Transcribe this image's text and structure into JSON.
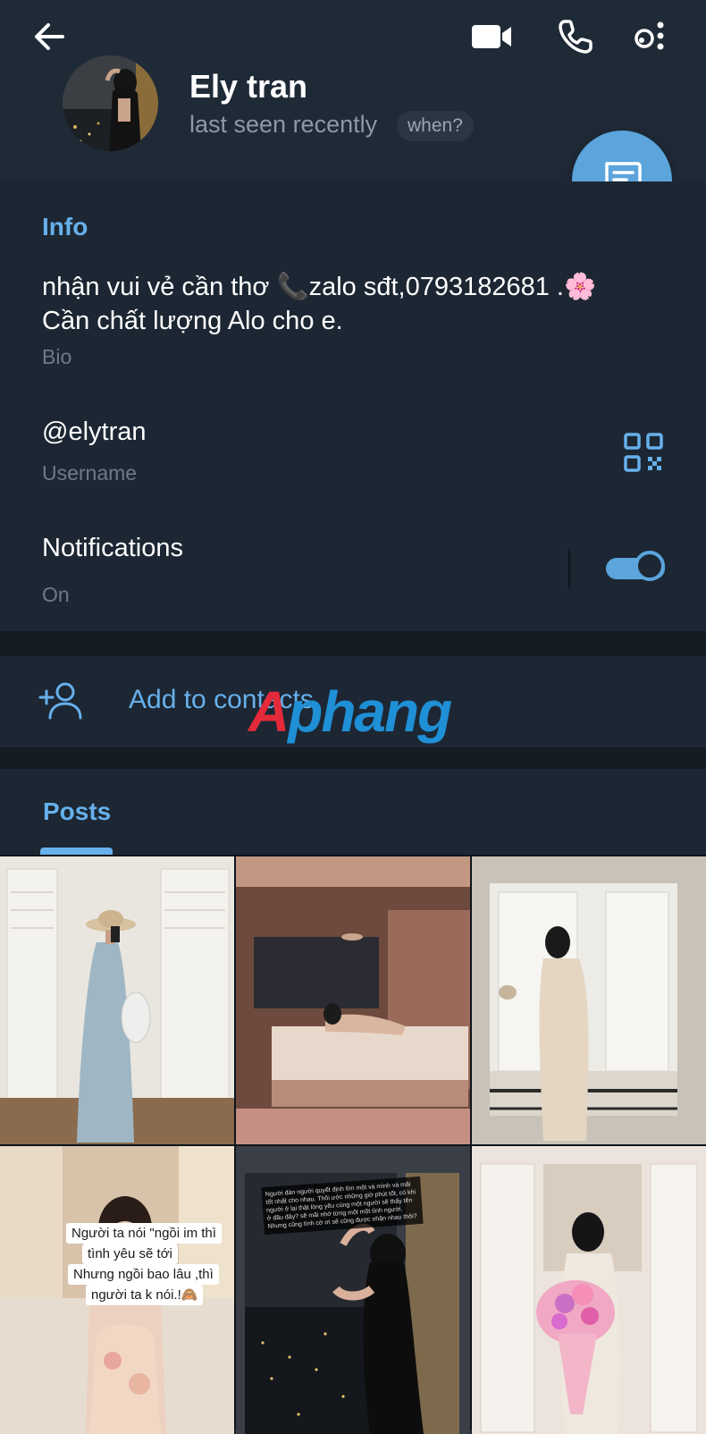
{
  "header": {
    "name": "Ely tran",
    "status": "last seen recently",
    "when_badge": "when?"
  },
  "info": {
    "section_title": "Info",
    "bio": {
      "line1": "nhận vui vẻ cần thơ 📞zalo sđt,0793182681 .🌸",
      "line2": "Cần chất lượng Alo cho e.",
      "label": "Bio"
    },
    "username": {
      "value": "@elytran",
      "label": "Username"
    },
    "notifications": {
      "label": "Notifications",
      "value": "On",
      "enabled": true
    }
  },
  "actions": {
    "add_to_contacts": "Add to contacts"
  },
  "watermark": {
    "part1": "A",
    "part2": "phang"
  },
  "posts": {
    "tab_label": "Posts",
    "captions": {
      "post4": [
        "Người ta nói \"ngồi im thì",
        "tình yêu sẽ tới",
        "Nhưng ngồi bao lâu ,thì",
        "người ta k nói.!🙈"
      ],
      "post5": "Người đàn người quyết định tìm một và mình và mãi tốt nhất cho nhau. Thôi ước những giờ phút tốt, có khi người ở lại thật lòng yêu cùng một người sẽ thấy tên ở đâu đây? sẽ mãi nhớ từng một một tình người. Nhưng cũng tình cờ ơi sẽ cũng được nhận nhau thôi?"
    }
  },
  "colors": {
    "accent": "#67b0ec",
    "fab": "#5ba4dc",
    "background": "#1c2733",
    "header": "#1f2a37"
  },
  "icons": {
    "back": "arrow-left-icon",
    "video": "video-camera-icon",
    "call": "phone-icon",
    "more": "more-vertical-icon",
    "message": "message-icon",
    "qr": "qr-code-icon",
    "add_contact": "add-contact-icon"
  }
}
